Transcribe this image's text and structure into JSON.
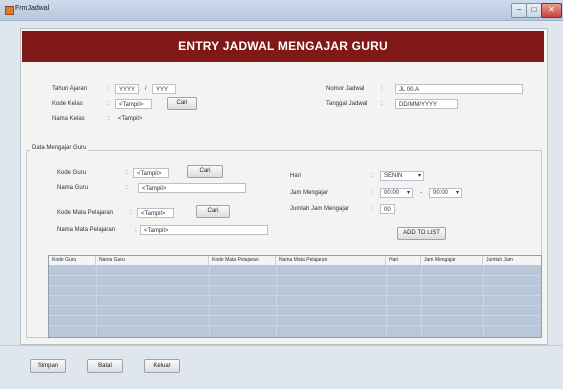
{
  "window": {
    "title": "FrmJadwal",
    "min": "–",
    "max": "□",
    "close": "✕"
  },
  "header": {
    "title": "ENTRY JADWAL MENGAJAR GURU"
  },
  "top": {
    "tahun_ajaran_label": "Tahun Ajaran",
    "tahun_ajaran_from": "YYYY",
    "tahun_ajaran_sep": "/",
    "tahun_ajaran_to": "YYY",
    "kode_kelas_label": "Kode Kelas",
    "kode_kelas_value": "<Tampil>",
    "cari1": "Cari",
    "nama_kelas_label": "Nama Kelas",
    "nama_kelas_value": "<Tampil>",
    "nomor_jadwal_label": "Nomor Jadwal",
    "nomor_jadwal_value": "JL 00.A",
    "tanggal_jadwal_label": "Tanggal Jadwal",
    "tanggal_jadwal_value": "DD/MM/YYYY"
  },
  "group": {
    "title": "Data Mengajar Guru",
    "kode_guru_label": "Kode Guru",
    "kode_guru_value": "<Tampil>",
    "cari2": "Cari",
    "nama_guru_label": "Nama Guru",
    "nama_guru_value": "<Tampil>",
    "kode_mapel_label": "Kode Mata Pelajaran",
    "kode_mapel_value": "<Tampil>",
    "cari3": "Cari",
    "nama_mapel_label": "Nama Mata Pelajaran",
    "nama_mapel_value": "<Tampil>",
    "hari_label": "Hari",
    "hari_value": "SENIN",
    "jam_label": "Jam Mengajar",
    "jam_from": "00:00",
    "jam_dash": "-",
    "jam_to": "00:00",
    "jumlah_label": "Jumlah Jam Mengajar",
    "jumlah_value": "00",
    "add_button": "ADD TO LIST"
  },
  "table": {
    "columns": [
      "Kode Guru",
      "Nama Guru",
      "Kode Mata Pelajaran",
      "Nama Mata Pelajaran",
      "Hari",
      "Jam Mengajar",
      "Jumlah Jam"
    ]
  },
  "footer": {
    "simpan": "Simpan",
    "batal": "Batal",
    "keluar": "Keluar"
  }
}
